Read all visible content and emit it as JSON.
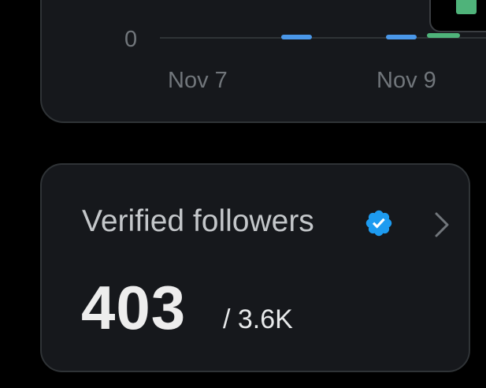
{
  "chart": {
    "y_ticks": [
      "0"
    ],
    "x_ticks": [
      "Nov 7",
      "Nov 9"
    ],
    "colors": {
      "series_blue": "#4a97e8",
      "series_green": "#4fb37a"
    }
  },
  "verified_followers": {
    "title": "Verified followers",
    "count": "403",
    "total": "/ 3.6K",
    "badge_icon": "verified-badge-icon",
    "chevron_icon": "chevron-right-icon",
    "badge_color": "#1d9bf0"
  }
}
